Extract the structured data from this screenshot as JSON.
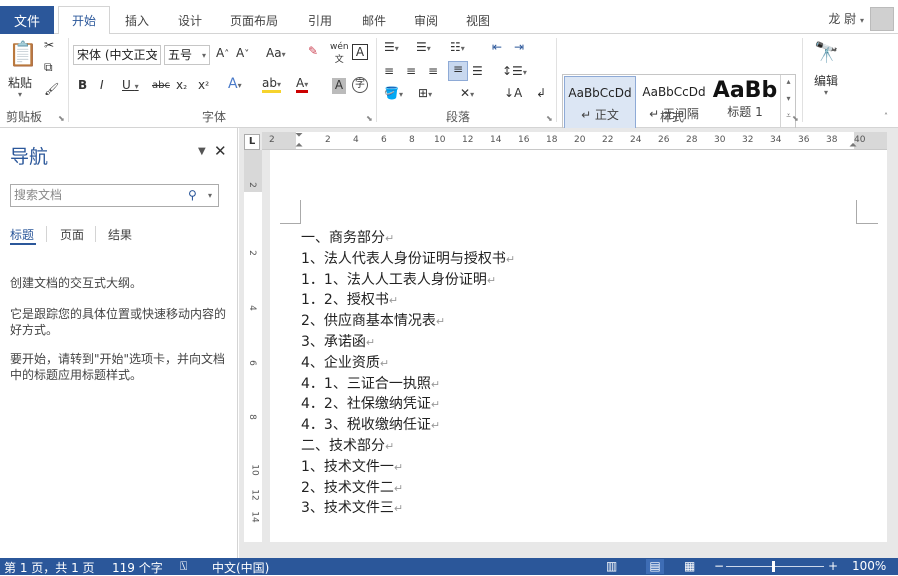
{
  "tabs": {
    "file": "文件",
    "home": "开始",
    "insert": "插入",
    "design": "设计",
    "layout": "页面布局",
    "references": "引用",
    "mailings": "邮件",
    "review": "审阅",
    "view": "视图"
  },
  "user": {
    "name": "龙 尉"
  },
  "ribbon": {
    "clipboard": {
      "paste": "粘贴",
      "label": "剪贴板"
    },
    "font": {
      "name": "宋体 (中文正文",
      "size": "五号",
      "label": "字体",
      "pinyin": "wén"
    },
    "paragraph": {
      "label": "段落"
    },
    "styles": {
      "label": "样式",
      "items": [
        {
          "sample": "AaBbCcDd",
          "name": "↵ 正文"
        },
        {
          "sample": "AaBbCcDd",
          "name": "↵ 无间隔"
        },
        {
          "sample": "AaBb",
          "name": "标题 1"
        }
      ]
    },
    "editing": {
      "label": "编辑"
    }
  },
  "nav": {
    "title": "导航",
    "search_placeholder": "搜索文档",
    "tabs": [
      "标题",
      "页面",
      "结果"
    ],
    "p1": "创建文档的交互式大纲。",
    "p2": "它是跟踪您的具体位置或快速移动内容的好方式。",
    "p3": "要开始，请转到\"开始\"选项卡，并向文档中的标题应用标题样式。"
  },
  "ruler": {
    "ticks": [
      "2",
      "2",
      "4",
      "6",
      "8",
      "10",
      "12",
      "14",
      "16",
      "18",
      "20",
      "22",
      "24",
      "26",
      "28",
      "30",
      "32",
      "34",
      "36",
      "38",
      "40"
    ],
    "vticks": [
      "2",
      "2",
      "4",
      "6",
      "8",
      "10",
      "12",
      "14"
    ]
  },
  "document": {
    "lines": [
      "一、商务部分",
      "1、法人代表人身份证明与授权书",
      "1．1、法人人工表人身份证明",
      "1．2、授权书",
      "2、供应商基本情况表",
      "3、承诺函",
      "4、企业资质",
      "4．1、三证合一执照",
      "4．2、社保缴纳凭证",
      "4．3、税收缴纳任证",
      "二、技术部分",
      "1、技术文件一",
      "2、技术文件二",
      "3、技术文件三"
    ]
  },
  "status": {
    "page": "第 1 页，共 1 页",
    "words": "119 个字",
    "lang": "中文(中国)",
    "zoom": "100%"
  },
  "colors": {
    "accent": "#2b579a"
  }
}
